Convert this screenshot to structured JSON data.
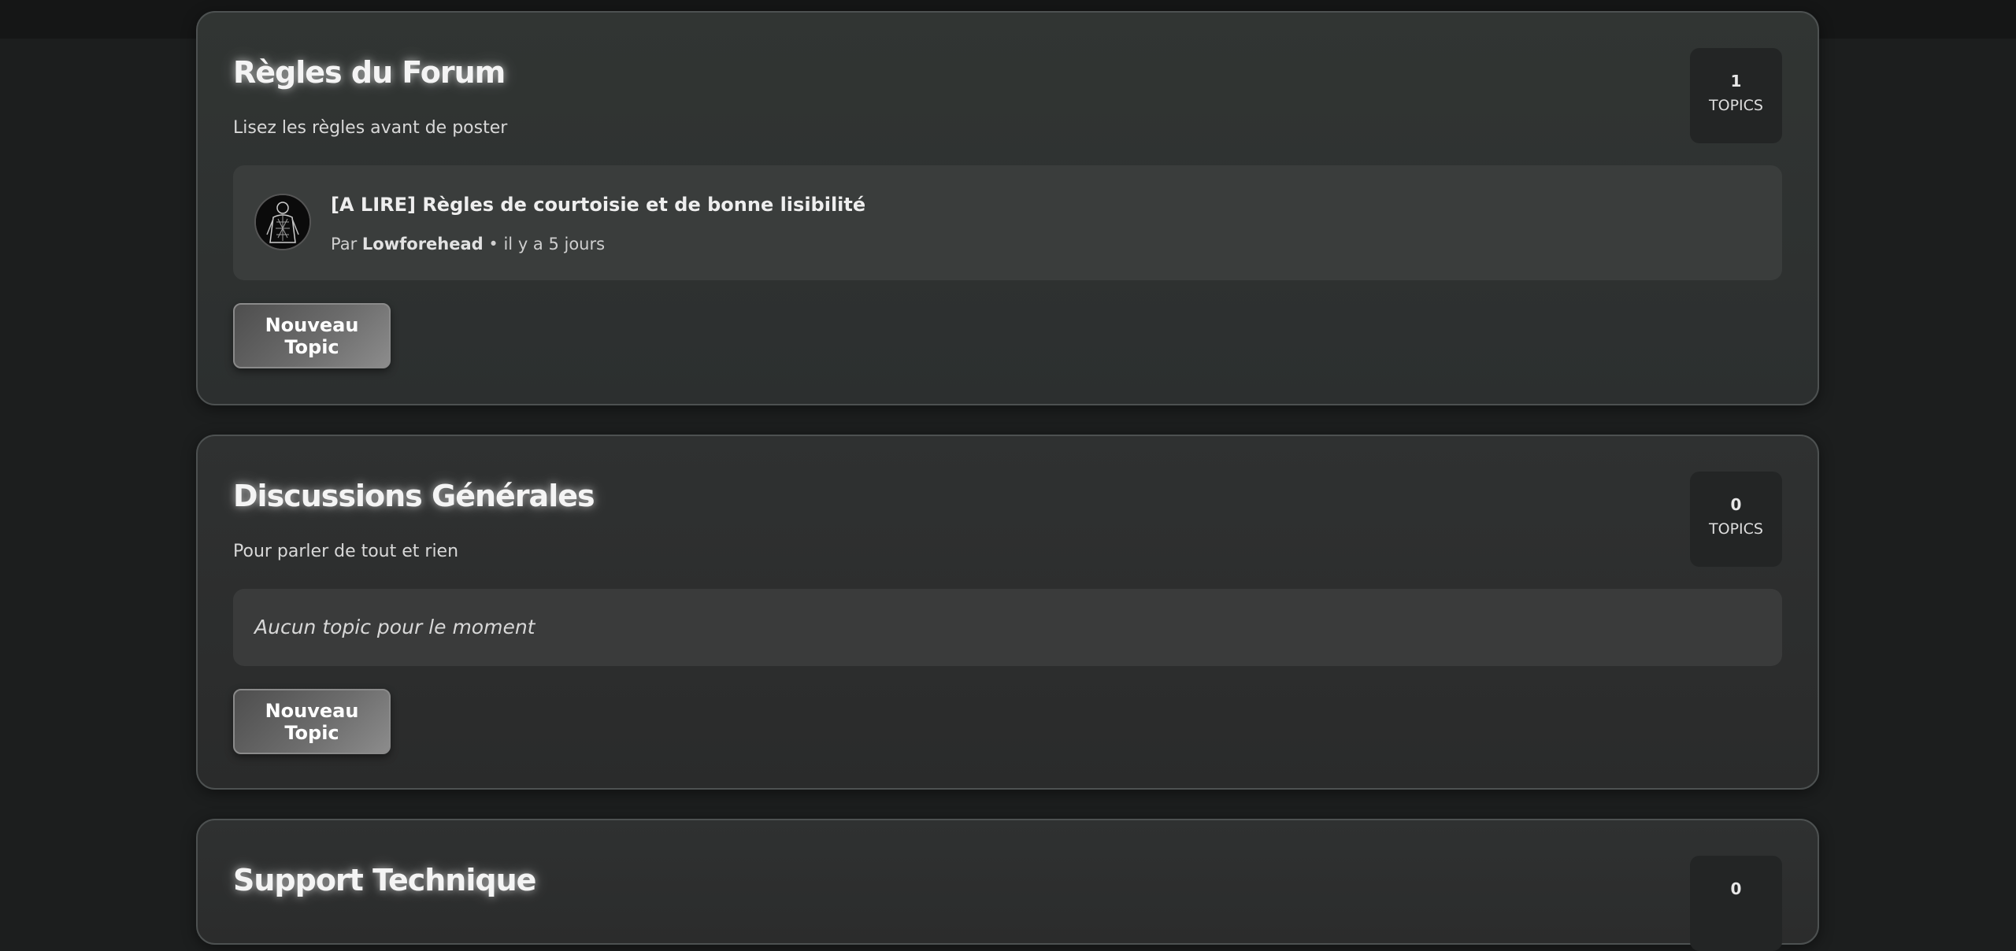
{
  "categories": [
    {
      "title": "Règles du Forum",
      "description": "Lisez les règles avant de poster",
      "topic_count": "1",
      "topic_count_label": "TOPICS",
      "topics": [
        {
          "title": "[A LIRE] Règles de courtoisie et de bonne lisibilité",
          "by_prefix": "Par",
          "author": "Lowforehead",
          "separator": "•",
          "time": "il y a 5 jours"
        }
      ],
      "new_topic_label": "Nouveau Topic"
    },
    {
      "title": "Discussions Générales",
      "description": "Pour parler de tout et rien",
      "topic_count": "0",
      "topic_count_label": "TOPICS",
      "empty_message": "Aucun topic pour le moment",
      "new_topic_label": "Nouveau Topic"
    },
    {
      "title": "Support Technique",
      "topic_count": "0"
    }
  ]
}
